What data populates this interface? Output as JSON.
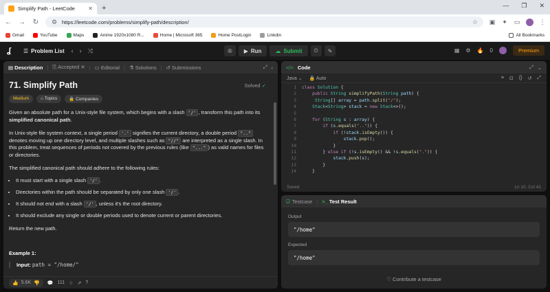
{
  "browser": {
    "tab_title": "Simplify Path - LeetCode",
    "url": "https://leetcode.com/problems/simplify-path/description/",
    "bookmarks": [
      "Gmail",
      "YouTube",
      "Maps",
      "Anime 1920x1080 R...",
      "Home | Microsoft 365",
      "Home PostLogin",
      "Linkdin"
    ],
    "all_bookmarks": "All Bookmarks"
  },
  "navbar": {
    "problem_list": "Problem List",
    "run": "Run",
    "submit": "Submit",
    "streak_count": "0",
    "premium": "Premium"
  },
  "left_tabs": [
    "Description",
    "Accepted",
    "Editorial",
    "Solutions",
    "Submissions"
  ],
  "problem": {
    "title": "71. Simplify Path",
    "status": "Solved",
    "difficulty": "Medium",
    "topics": "Topics",
    "companies": "Companies",
    "p1_pre": "Given an absolute path for a Unix-style file system, which begins with a slash ",
    "p1_code": "'/'",
    "p1_mid": ", transform this path into its ",
    "p1_bold": "simplified canonical path",
    "p1_end": ".",
    "p2_a": "In Unix-style file system context, a single period ",
    "p2_c1": "'.'",
    "p2_b": " signifies the current directory, a double period ",
    "p2_c2": "\"..\"",
    "p2_c": " denotes moving up one directory level, and multiple slashes such as ",
    "p2_c3": "\"//\"",
    "p2_d": " are interpreted as a single slash. In this problem, treat sequences of periods not covered by the previous rules (like ",
    "p2_c4": "\"...\"",
    "p2_e": ") as valid names for files or directories.",
    "p3": "The simplified canonical path should adhere to the following rules:",
    "rule1_pre": "It must start with a single slash ",
    "rule1_code": "'/'",
    "rule1_end": ".",
    "rule2_pre": "Directories within the path should be separated by only one slash ",
    "rule2_code": "'/'",
    "rule2_end": ".",
    "rule3_pre": "It should not end with a slash ",
    "rule3_code": "'/'",
    "rule3_end": ", unless it's the root directory.",
    "rule4": "It should exclude any single or double periods used to denote current or parent directories.",
    "p4": "Return the new path.",
    "example_title": "Example 1:",
    "example_input_label": "Input:",
    "example_input_value": "path = \"/home/\""
  },
  "desc_footer": {
    "likes": "5.6K",
    "comments": "111"
  },
  "code_panel": {
    "title": "Code",
    "language": "Java",
    "mode": "Auto",
    "saved": "Saved",
    "cursor": "Ln 10, Col 41",
    "line_numbers": [
      "1",
      "2",
      "3",
      "4",
      "5",
      "6",
      "7",
      "8",
      "9",
      "10",
      "11",
      "12",
      "13",
      "14"
    ]
  },
  "testcase_panel": {
    "tab_testcase": "Testcase",
    "tab_result": "Test Result",
    "output_label": "Output",
    "output_value": "\"/home\"",
    "expected_label": "Expected",
    "expected_value": "\"/home\"",
    "contribute": "Contribute a testcase"
  },
  "colors": {
    "accent_orange": "#ffa116",
    "success_green": "#2cbb5d",
    "medium_yellow": "#ffc01e",
    "panel_bg": "#262626"
  }
}
